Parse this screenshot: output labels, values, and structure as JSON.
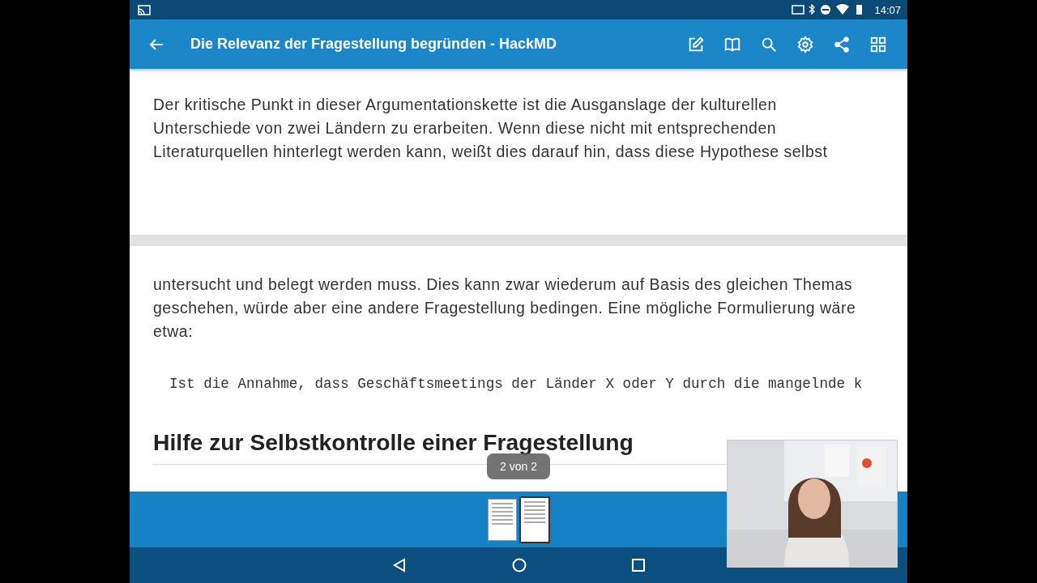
{
  "status_bar": {
    "time": "14:07"
  },
  "app_bar": {
    "title": "Die Relevanz der Fragestellung begründen - HackMD"
  },
  "page_1": {
    "paragraph": "Der kritische Punkt in dieser Argumentationskette ist die Ausganslage der kulturellen Unterschiede von zwei Ländern zu erarbeiten. Wenn diese nicht mit entsprechenden Literaturquellen hinterlegt werden kann, weißt dies darauf hin, dass diese Hypothese selbst"
  },
  "page_2": {
    "paragraph": "untersucht und belegt werden muss. Dies kann zwar wiederum auf Basis des gleichen Themas geschehen, würde aber eine andere Fragestellung bedingen. Eine mögliche Formulierung wäre etwa:",
    "code_line": "Ist die Annahme, dass Geschäftsmeetings der Länder X oder Y durch die mangelnde k",
    "heading": "Hilfe zur Selbstkontrolle einer Fragestellung"
  },
  "page_indicator": "2 von 2",
  "thumbnails": [
    {
      "selected": false
    },
    {
      "selected": true
    }
  ]
}
